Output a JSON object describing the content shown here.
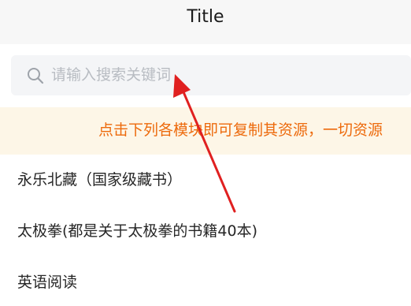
{
  "header": {
    "title": "Title"
  },
  "search": {
    "placeholder": "请输入搜索关键词",
    "icon": "search-icon"
  },
  "notice": {
    "text": "点击下列各模块即可复制其资源，一切资源",
    "color": "#ed6a0c",
    "background": "#fdf6e7"
  },
  "list": {
    "items": [
      {
        "label": "永乐北藏（国家级藏书）"
      },
      {
        "label": "太极拳(都是关于太极拳的书籍40本)"
      },
      {
        "label": "英语阅读"
      }
    ]
  },
  "annotation": {
    "arrow_color": "#e02020"
  }
}
